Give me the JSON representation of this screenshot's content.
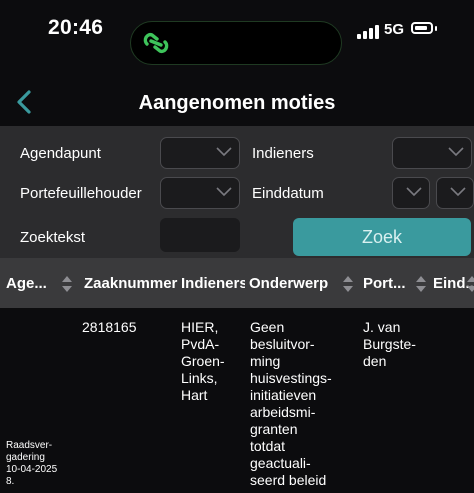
{
  "status": {
    "time": "20:46",
    "network": "5G"
  },
  "nav": {
    "title": "Aangenomen moties"
  },
  "filters": {
    "agendapunt_label": "Agendapunt",
    "indieners_label": "Indieners",
    "portefeuillehouder_label": "Portefeuillehouder",
    "einddatum_label": "Einddatum",
    "zoektekst_label": "Zoektekst",
    "zoek_label": "Zoek"
  },
  "table": {
    "headers": [
      "Age...",
      "Zaaknummer",
      "Indieners",
      "Onderwerp",
      "Port...",
      "Eind..."
    ],
    "rows": [
      {
        "agenda": [
          "Raadsver-",
          "gadering",
          "10-04-2025",
          "8."
        ],
        "zaaknummer": "2818165",
        "indieners": [
          "HIER,",
          "PvdA-",
          "Groen-",
          "Links,",
          "Hart"
        ],
        "onderwerp": [
          "Geen",
          "besluitvor-",
          "ming",
          "huisvestings-",
          "initiatieven",
          "arbeidsmi-",
          "granten",
          "totdat",
          "geactuali-",
          "seerd beleid"
        ],
        "portefeuillehouder": [
          "J. van",
          "Burgste-",
          "den"
        ]
      }
    ]
  },
  "colors": {
    "accent": "#3a9a9e",
    "panel": "#2c2c2e",
    "header": "#3a3a3c"
  },
  "icons": [
    "link-icon",
    "signal-icon",
    "battery-icon",
    "back-chevron-icon",
    "chevron-down-icon",
    "sort-icon"
  ]
}
